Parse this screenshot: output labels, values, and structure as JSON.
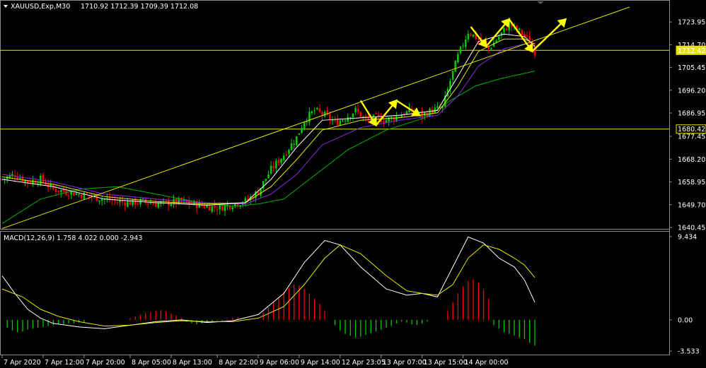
{
  "chart_data": [
    {
      "type": "candlestick",
      "symbol_label": "XAUUSD,Exp,M30",
      "ohlc_label": "1710.92 1712.39 1709.39 1712.08",
      "ylim": [
        1640.45,
        1730.0
      ],
      "y_ticks": [
        "1723.95",
        "1714.70",
        "1705.45",
        "1696.20",
        "1686.95",
        "1677.45",
        "1668.20",
        "1658.95",
        "1649.70",
        "1640.45"
      ],
      "y_tick_values": [
        1723.95,
        1714.7,
        1705.45,
        1696.2,
        1686.95,
        1677.45,
        1668.2,
        1658.95,
        1649.7,
        1640.45
      ],
      "price_markers": [
        {
          "label": "1712.42",
          "value": 1712.42
        },
        {
          "label": "1680.42",
          "value": 1680.42
        }
      ],
      "colors": {
        "bull": "#00c800",
        "bear": "#ff0000",
        "ma_fast": "#ffffff",
        "ma_mid": "#e6e600",
        "ma_slow": "#8a2be2",
        "ma_long": "#00b400",
        "trendline": "#e6e600",
        "hline": "#e6e600",
        "arrows": "#ffff00"
      },
      "close_path": [
        [
          0,
          1660
        ],
        [
          5,
          1662
        ],
        [
          10,
          1659
        ],
        [
          15,
          1660
        ],
        [
          20,
          1656
        ],
        [
          25,
          1655
        ],
        [
          30,
          1654
        ],
        [
          35,
          1653
        ],
        [
          40,
          1652
        ],
        [
          45,
          1651
        ],
        [
          50,
          1650.5
        ],
        [
          55,
          1651
        ],
        [
          60,
          1650
        ],
        [
          65,
          1650.5
        ],
        [
          70,
          1651
        ],
        [
          75,
          1650
        ],
        [
          80,
          1649
        ],
        [
          85,
          1648.5
        ],
        [
          90,
          1650
        ],
        [
          95,
          1651
        ],
        [
          100,
          1655
        ],
        [
          105,
          1664
        ],
        [
          110,
          1670
        ],
        [
          115,
          1677
        ],
        [
          118,
          1684
        ],
        [
          122,
          1688
        ],
        [
          126,
          1686
        ],
        [
          130,
          1683
        ],
        [
          134,
          1685
        ],
        [
          138,
          1688
        ],
        [
          142,
          1684
        ],
        [
          146,
          1685
        ],
        [
          150,
          1684
        ],
        [
          155,
          1686
        ],
        [
          160,
          1688
        ],
        [
          164,
          1686
        ],
        [
          168,
          1688
        ],
        [
          172,
          1689
        ],
        [
          175,
          1700
        ],
        [
          178,
          1710
        ],
        [
          182,
          1720
        ],
        [
          186,
          1717
        ],
        [
          190,
          1713
        ],
        [
          194,
          1718
        ],
        [
          198,
          1723
        ],
        [
          202,
          1720
        ],
        [
          206,
          1716
        ],
        [
          208,
          1712
        ]
      ],
      "ma_fast_path": [
        [
          0,
          1660
        ],
        [
          20,
          1657
        ],
        [
          40,
          1652
        ],
        [
          60,
          1650.5
        ],
        [
          80,
          1649.5
        ],
        [
          95,
          1650.5
        ],
        [
          105,
          1660
        ],
        [
          115,
          1673
        ],
        [
          125,
          1684
        ],
        [
          140,
          1685
        ],
        [
          155,
          1686
        ],
        [
          170,
          1688
        ],
        [
          178,
          1702
        ],
        [
          186,
          1716
        ],
        [
          196,
          1719
        ],
        [
          204,
          1718
        ],
        [
          208,
          1714
        ]
      ],
      "ma_mid_path": [
        [
          0,
          1661
        ],
        [
          20,
          1658
        ],
        [
          40,
          1653
        ],
        [
          60,
          1651
        ],
        [
          80,
          1650
        ],
        [
          95,
          1650.5
        ],
        [
          105,
          1657
        ],
        [
          115,
          1668
        ],
        [
          125,
          1680
        ],
        [
          140,
          1684
        ],
        [
          155,
          1685
        ],
        [
          170,
          1687
        ],
        [
          178,
          1698
        ],
        [
          186,
          1712
        ],
        [
          196,
          1717
        ],
        [
          204,
          1717
        ],
        [
          208,
          1715
        ]
      ],
      "ma_slow_path": [
        [
          0,
          1662
        ],
        [
          20,
          1659
        ],
        [
          40,
          1654
        ],
        [
          60,
          1652
        ],
        [
          80,
          1650.5
        ],
        [
          95,
          1650
        ],
        [
          105,
          1654
        ],
        [
          115,
          1662
        ],
        [
          125,
          1674
        ],
        [
          140,
          1681
        ],
        [
          155,
          1684
        ],
        [
          170,
          1686
        ],
        [
          178,
          1694
        ],
        [
          186,
          1706
        ],
        [
          196,
          1713
        ],
        [
          204,
          1715
        ],
        [
          208,
          1714
        ]
      ],
      "ma_long_path": [
        [
          0,
          1642
        ],
        [
          15,
          1652
        ],
        [
          30,
          1656
        ],
        [
          45,
          1657
        ],
        [
          60,
          1654
        ],
        [
          75,
          1651
        ],
        [
          90,
          1649
        ],
        [
          100,
          1650
        ],
        [
          110,
          1652
        ],
        [
          120,
          1660
        ],
        [
          135,
          1672
        ],
        [
          150,
          1680
        ],
        [
          165,
          1685
        ],
        [
          175,
          1692
        ],
        [
          185,
          1698
        ],
        [
          195,
          1701
        ],
        [
          208,
          1704
        ]
      ],
      "trendline": [
        [
          0,
          1640
        ],
        [
          245,
          1730
        ]
      ],
      "hlines": [
        1712.42,
        1680.42
      ],
      "zigzag_groups": [
        [
          [
            140,
            1692
          ],
          [
            146,
            1682
          ],
          [
            154,
            1692
          ],
          [
            163,
            1686
          ]
        ],
        [
          [
            183,
            1722
          ],
          [
            189,
            1714
          ],
          [
            198,
            1725
          ],
          [
            207,
            1712
          ],
          [
            220,
            1725
          ]
        ]
      ]
    },
    {
      "type": "macd",
      "label": "MACD(12,26,9) 1.758 4.022 0.000 -2.943",
      "ylim": [
        -3.533,
        9.434
      ],
      "y_ticks": [
        "9.434",
        "0.00",
        "-3.533"
      ],
      "y_tick_values": [
        9.434,
        0.0,
        -3.533
      ],
      "colors": {
        "main": "#ffffff",
        "signal": "#e6e600",
        "hist_pos": "#ff0000",
        "hist_neg": "#00c800"
      },
      "main_path": [
        [
          0,
          5
        ],
        [
          5,
          3
        ],
        [
          10,
          1.2
        ],
        [
          15,
          0.2
        ],
        [
          20,
          -0.4
        ],
        [
          30,
          -0.8
        ],
        [
          40,
          -1.0
        ],
        [
          50,
          -0.6
        ],
        [
          60,
          -0.2
        ],
        [
          70,
          0.0
        ],
        [
          80,
          -0.3
        ],
        [
          90,
          -0.1
        ],
        [
          100,
          0.6
        ],
        [
          110,
          3.0
        ],
        [
          118,
          6.5
        ],
        [
          126,
          9.0
        ],
        [
          132,
          8.5
        ],
        [
          140,
          6.0
        ],
        [
          150,
          3.5
        ],
        [
          158,
          2.8
        ],
        [
          164,
          3.0
        ],
        [
          170,
          2.6
        ],
        [
          176,
          6.0
        ],
        [
          182,
          9.4
        ],
        [
          188,
          8.7
        ],
        [
          194,
          7.0
        ],
        [
          200,
          6.0
        ],
        [
          204,
          4.5
        ],
        [
          208,
          2.0
        ]
      ],
      "signal_path": [
        [
          0,
          3.5
        ],
        [
          8,
          2.6
        ],
        [
          15,
          1.2
        ],
        [
          22,
          0.4
        ],
        [
          30,
          -0.2
        ],
        [
          40,
          -0.7
        ],
        [
          50,
          -0.6
        ],
        [
          60,
          -0.3
        ],
        [
          70,
          -0.1
        ],
        [
          80,
          -0.2
        ],
        [
          90,
          -0.2
        ],
        [
          100,
          0.2
        ],
        [
          110,
          1.5
        ],
        [
          118,
          4.0
        ],
        [
          126,
          7.0
        ],
        [
          132,
          8.5
        ],
        [
          140,
          7.5
        ],
        [
          150,
          5.0
        ],
        [
          158,
          3.3
        ],
        [
          164,
          3.0
        ],
        [
          170,
          2.8
        ],
        [
          176,
          4.0
        ],
        [
          182,
          7.0
        ],
        [
          188,
          8.5
        ],
        [
          194,
          8.0
        ],
        [
          200,
          7.0
        ],
        [
          204,
          6.2
        ],
        [
          208,
          4.8
        ]
      ],
      "histogram": [
        [
          2,
          -0.9
        ],
        [
          4,
          -1.2
        ],
        [
          6,
          -1.4
        ],
        [
          8,
          -1.3
        ],
        [
          10,
          -1.1
        ],
        [
          12,
          -1.0
        ],
        [
          14,
          -0.9
        ],
        [
          16,
          -0.8
        ],
        [
          18,
          -0.7
        ],
        [
          20,
          -0.6
        ],
        [
          22,
          -0.5
        ],
        [
          24,
          -0.5
        ],
        [
          26,
          -0.4
        ],
        [
          28,
          -0.4
        ],
        [
          30,
          -0.3
        ],
        [
          32,
          -0.3
        ],
        [
          50,
          0.2
        ],
        [
          52,
          0.4
        ],
        [
          54,
          0.6
        ],
        [
          56,
          0.8
        ],
        [
          58,
          0.9
        ],
        [
          60,
          1.0
        ],
        [
          62,
          1.1
        ],
        [
          64,
          0.9
        ],
        [
          66,
          0.7
        ],
        [
          68,
          0.5
        ],
        [
          70,
          0.2
        ],
        [
          72,
          -0.2
        ],
        [
          74,
          -0.4
        ],
        [
          76,
          -0.5
        ],
        [
          78,
          -0.4
        ],
        [
          80,
          -0.3
        ],
        [
          82,
          -0.2
        ],
        [
          84,
          -0.1
        ],
        [
          86,
          -0.1
        ],
        [
          88,
          0.1
        ],
        [
          90,
          0.2
        ],
        [
          92,
          0.3
        ],
        [
          102,
          0.8
        ],
        [
          104,
          1.4
        ],
        [
          106,
          2.0
        ],
        [
          108,
          2.6
        ],
        [
          110,
          3.2
        ],
        [
          112,
          3.6
        ],
        [
          114,
          4.0
        ],
        [
          116,
          3.9
        ],
        [
          118,
          3.5
        ],
        [
          120,
          3.0
        ],
        [
          122,
          2.4
        ],
        [
          124,
          1.8
        ],
        [
          126,
          1.0
        ],
        [
          130,
          -0.6
        ],
        [
          132,
          -1.2
        ],
        [
          134,
          -1.6
        ],
        [
          136,
          -1.8
        ],
        [
          138,
          -2.0
        ],
        [
          140,
          -1.9
        ],
        [
          142,
          -1.7
        ],
        [
          144,
          -1.5
        ],
        [
          146,
          -1.3
        ],
        [
          148,
          -1.1
        ],
        [
          150,
          -0.9
        ],
        [
          152,
          -0.7
        ],
        [
          154,
          -0.4
        ],
        [
          156,
          -0.2
        ],
        [
          158,
          -0.3
        ],
        [
          160,
          -0.5
        ],
        [
          162,
          -0.6
        ],
        [
          164,
          -0.4
        ],
        [
          166,
          -0.2
        ],
        [
          174,
          1.0
        ],
        [
          176,
          2.0
        ],
        [
          178,
          3.0
        ],
        [
          180,
          3.8
        ],
        [
          182,
          4.4
        ],
        [
          184,
          4.6
        ],
        [
          186,
          4.2
        ],
        [
          188,
          3.4
        ],
        [
          190,
          2.4
        ],
        [
          192,
          -0.6
        ],
        [
          194,
          -1.0
        ],
        [
          196,
          -1.4
        ],
        [
          198,
          -1.6
        ],
        [
          200,
          -1.8
        ],
        [
          202,
          -2.0
        ],
        [
          204,
          -2.2
        ],
        [
          206,
          -2.6
        ],
        [
          208,
          -2.9
        ]
      ]
    }
  ],
  "x_ticks": [
    {
      "label": "7 Apr 2020",
      "i": 0
    },
    {
      "label": "7 Apr 12:00",
      "i": 16
    },
    {
      "label": "7 Apr 20:00",
      "i": 32
    },
    {
      "label": "8 Apr 05:00",
      "i": 50
    },
    {
      "label": "8 Apr 13:00",
      "i": 66
    },
    {
      "label": "8 Apr 22:00",
      "i": 84
    },
    {
      "label": "9 Apr 06:00",
      "i": 100
    },
    {
      "label": "9 Apr 14:00",
      "i": 116
    },
    {
      "label": "12 Apr 23:05",
      "i": 132
    },
    {
      "label": "13 Apr 07:00",
      "i": 148
    },
    {
      "label": "13 Apr 15:00",
      "i": 164
    },
    {
      "label": "14 Apr 00:00",
      "i": 180
    }
  ]
}
